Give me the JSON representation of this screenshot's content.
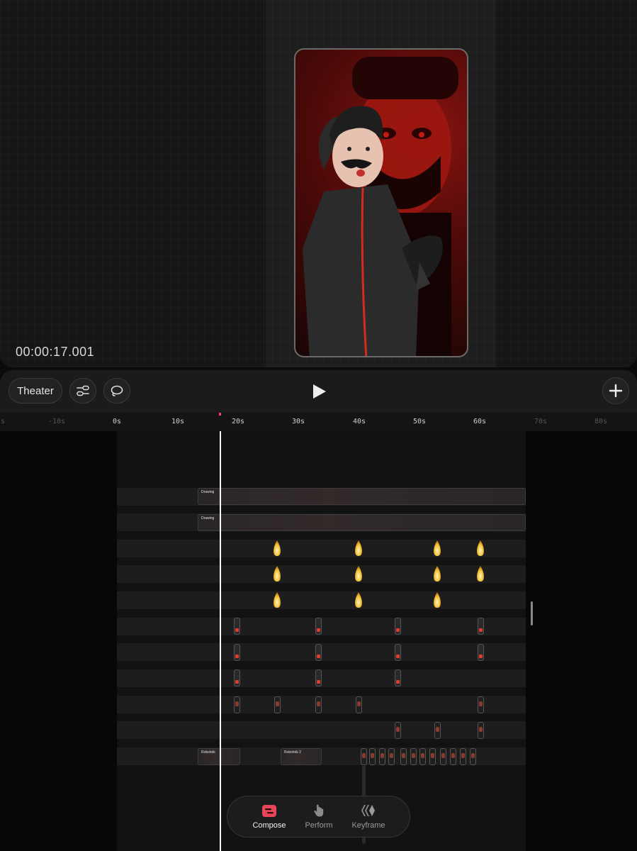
{
  "preview": {
    "timecode": "00:00:17.001"
  },
  "toolbar": {
    "theater_label": "Theater",
    "adjust_icon": "sliders-icon",
    "lasso_icon": "lasso-icon",
    "play_icon": "play-icon",
    "add_icon": "plus-icon"
  },
  "ruler": {
    "ticks": [
      "s",
      "-10s",
      "0s",
      "10s",
      "20s",
      "30s",
      "40s",
      "50s",
      "60s",
      "70s",
      "80s"
    ]
  },
  "tracks": {
    "drawing_clip_1": "Drawing",
    "drawing_clip_2": "Drawing",
    "clip_robotnik": "Robotnik",
    "clip_robotnik_2": "Robotnik 2"
  },
  "bottom_nav": {
    "items": [
      {
        "label": "Compose",
        "icon": "compose-icon",
        "active": true
      },
      {
        "label": "Perform",
        "icon": "hand-icon",
        "active": false
      },
      {
        "label": "Keyframe",
        "icon": "keyframe-icon",
        "active": false
      }
    ]
  },
  "colors": {
    "accent": "#e8445a",
    "playhead": "#ffffff",
    "canvas_red": "#8a1410"
  }
}
